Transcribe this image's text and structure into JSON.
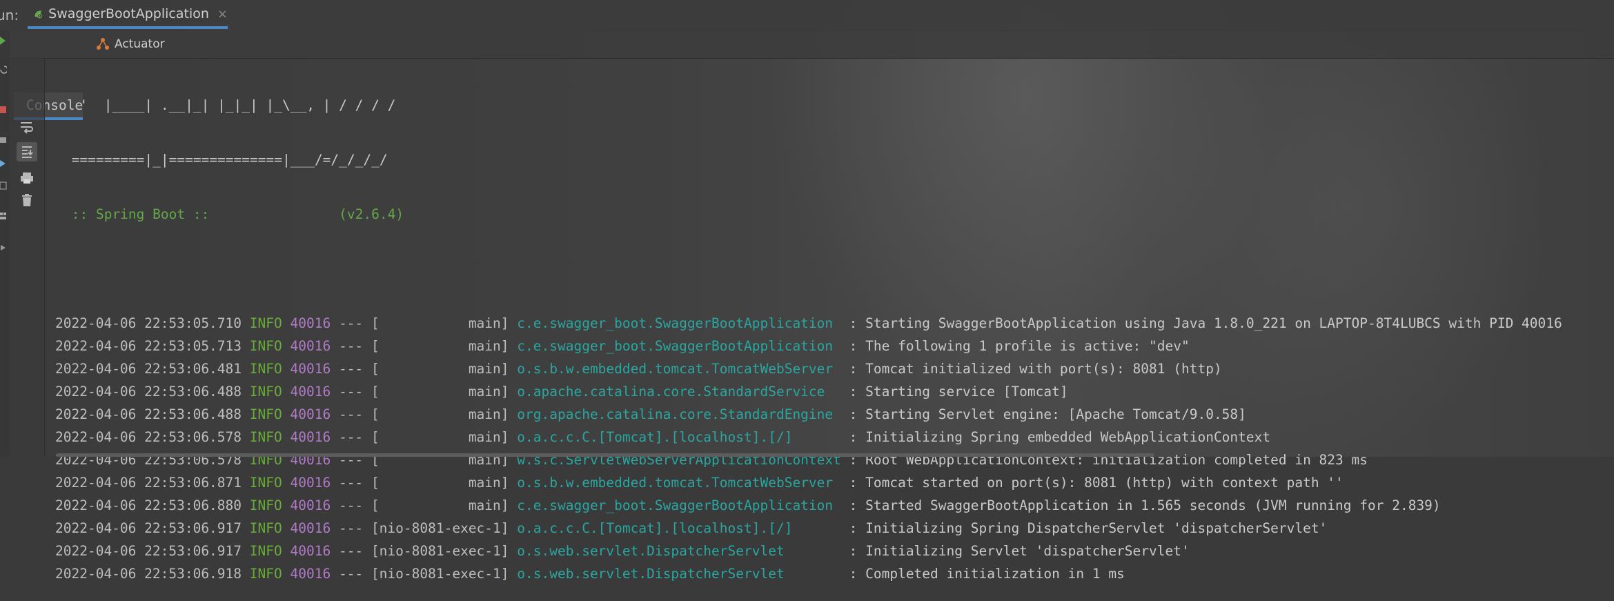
{
  "run_tab": {
    "label": "Run:",
    "title": "SwaggerBootApplication",
    "close": "×"
  },
  "subtabs": {
    "console": "Console",
    "actuator": "Actuator"
  },
  "banner": [
    "  '  |____| .__|_| |_|_| |_\\__, | / / / /",
    " =========|_|==============|___/=/_/_/_/",
    " :: Spring Boot ::                (v2.6.4)"
  ],
  "log": [
    {
      "ts": "2022-04-06 22:53:05.710",
      "lvl": "INFO",
      "pid": "40016",
      "sep": "---",
      "thread": "[           main]",
      "logger": "c.e.swagger_boot.SwaggerBootApplication ",
      "msg": ": Starting SwaggerBootApplication using Java 1.8.0_221 on LAPTOP-8T4LUBCS with PID 40016"
    },
    {
      "ts": "2022-04-06 22:53:05.713",
      "lvl": "INFO",
      "pid": "40016",
      "sep": "---",
      "thread": "[           main]",
      "logger": "c.e.swagger_boot.SwaggerBootApplication ",
      "msg": ": The following 1 profile is active: \"dev\""
    },
    {
      "ts": "2022-04-06 22:53:06.481",
      "lvl": "INFO",
      "pid": "40016",
      "sep": "---",
      "thread": "[           main]",
      "logger": "o.s.b.w.embedded.tomcat.TomcatWebServer ",
      "msg": ": Tomcat initialized with port(s): 8081 (http)"
    },
    {
      "ts": "2022-04-06 22:53:06.488",
      "lvl": "INFO",
      "pid": "40016",
      "sep": "---",
      "thread": "[           main]",
      "logger": "o.apache.catalina.core.StandardService  ",
      "msg": ": Starting service [Tomcat]"
    },
    {
      "ts": "2022-04-06 22:53:06.488",
      "lvl": "INFO",
      "pid": "40016",
      "sep": "---",
      "thread": "[           main]",
      "logger": "org.apache.catalina.core.StandardEngine ",
      "msg": ": Starting Servlet engine: [Apache Tomcat/9.0.58]"
    },
    {
      "ts": "2022-04-06 22:53:06.578",
      "lvl": "INFO",
      "pid": "40016",
      "sep": "---",
      "thread": "[           main]",
      "logger": "o.a.c.c.C.[Tomcat].[localhost].[/]      ",
      "msg": ": Initializing Spring embedded WebApplicationContext"
    },
    {
      "ts": "2022-04-06 22:53:06.578",
      "lvl": "INFO",
      "pid": "40016",
      "sep": "---",
      "thread": "[           main]",
      "logger": "w.s.c.ServletWebServerApplicationContext",
      "msg": ": Root WebApplicationContext: initialization completed in 823 ms"
    },
    {
      "ts": "2022-04-06 22:53:06.871",
      "lvl": "INFO",
      "pid": "40016",
      "sep": "---",
      "thread": "[           main]",
      "logger": "o.s.b.w.embedded.tomcat.TomcatWebServer ",
      "msg": ": Tomcat started on port(s): 8081 (http) with context path ''"
    },
    {
      "ts": "2022-04-06 22:53:06.880",
      "lvl": "INFO",
      "pid": "40016",
      "sep": "---",
      "thread": "[           main]",
      "logger": "c.e.swagger_boot.SwaggerBootApplication ",
      "msg": ": Started SwaggerBootApplication in 1.565 seconds (JVM running for 2.839)"
    },
    {
      "ts": "2022-04-06 22:53:06.917",
      "lvl": "INFO",
      "pid": "40016",
      "sep": "---",
      "thread": "[nio-8081-exec-1]",
      "logger": "o.a.c.c.C.[Tomcat].[localhost].[/]      ",
      "msg": ": Initializing Spring DispatcherServlet 'dispatcherServlet'"
    },
    {
      "ts": "2022-04-06 22:53:06.917",
      "lvl": "INFO",
      "pid": "40016",
      "sep": "---",
      "thread": "[nio-8081-exec-1]",
      "logger": "o.s.web.servlet.DispatcherServlet       ",
      "msg": ": Initializing Servlet 'dispatcherServlet'"
    },
    {
      "ts": "2022-04-06 22:53:06.918",
      "lvl": "INFO",
      "pid": "40016",
      "sep": "---",
      "thread": "[nio-8081-exec-1]",
      "logger": "o.s.web.servlet.DispatcherServlet       ",
      "msg": ": Completed initialization in 1 ms"
    }
  ],
  "colors": {
    "accent_tab": "#4a88c7",
    "info": "#6aab3a",
    "pid": "#b07ac6",
    "logger": "#2aa6a0",
    "spring": "#62a846"
  },
  "icons": [
    "spring-boot-icon",
    "actuator-icon",
    "soft-wrap-icon",
    "scroll-to-end-icon",
    "print-icon",
    "trash-icon"
  ]
}
